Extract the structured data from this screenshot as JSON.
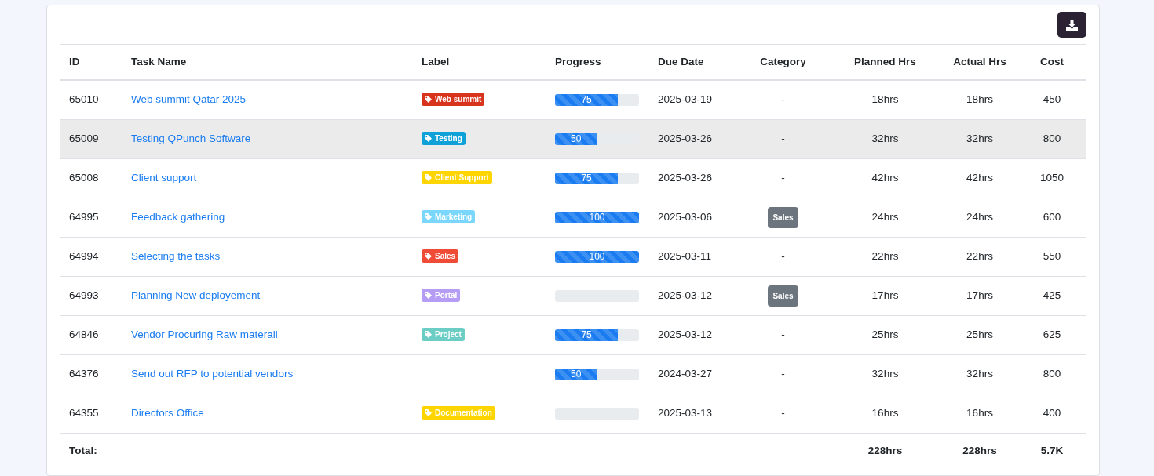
{
  "table": {
    "columns": [
      "ID",
      "Task Name",
      "Label",
      "Progress",
      "Due Date",
      "Category",
      "Planned Hrs",
      "Actual Hrs",
      "Cost"
    ],
    "rows": [
      {
        "id": "65010",
        "task": "Web summit Qatar 2025",
        "label": {
          "text": "Web summit",
          "color": "#d8341d"
        },
        "progress": {
          "level": 0.75,
          "text": "75"
        },
        "due": "2025-03-19",
        "category": "-",
        "planned": "18hrs",
        "actual": "18hrs",
        "cost": "450",
        "selected": false
      },
      {
        "id": "65009",
        "task": "Testing QPunch Software",
        "label": {
          "text": "Testing",
          "color": "#10a1d9"
        },
        "progress": {
          "level": 0.5,
          "text": "50"
        },
        "due": "2025-03-26",
        "category": "-",
        "planned": "32hrs",
        "actual": "32hrs",
        "cost": "800",
        "selected": true
      },
      {
        "id": "65008",
        "task": "Client support",
        "label": {
          "text": "Client Support",
          "color": "#ffd500"
        },
        "progress": {
          "level": 0.75,
          "text": "75"
        },
        "due": "2025-03-26",
        "category": "-",
        "planned": "42hrs",
        "actual": "42hrs",
        "cost": "1050",
        "selected": false
      },
      {
        "id": "64995",
        "task": "Feedback gathering",
        "label": {
          "text": "Marketing",
          "color": "#7ad6fb"
        },
        "progress": {
          "level": 1,
          "text": "100"
        },
        "due": "2025-03-06",
        "category_badge": "Sales",
        "planned": "24hrs",
        "actual": "24hrs",
        "cost": "600",
        "selected": false
      },
      {
        "id": "64994",
        "task": "Selecting the tasks",
        "label": {
          "text": "Sales",
          "color": "#f04b36"
        },
        "progress": {
          "level": 1,
          "text": "100"
        },
        "due": "2025-03-11",
        "category": "-",
        "planned": "22hrs",
        "actual": "22hrs",
        "cost": "550",
        "selected": false
      },
      {
        "id": "64993",
        "task": "Planning New deployement",
        "label": {
          "text": "Portal",
          "color": "#b59cf5"
        },
        "progress": {
          "level": 0
        },
        "due": "2025-03-12",
        "category_badge": "Sales",
        "planned": "17hrs",
        "actual": "17hrs",
        "cost": "425",
        "selected": false
      },
      {
        "id": "64846",
        "task": "Vendor Procuring Raw materail",
        "label": {
          "text": "Project",
          "color": "#6ccdc5"
        },
        "progress": {
          "level": 0.75,
          "text": "75"
        },
        "due": "2025-03-12",
        "category": "-",
        "planned": "25hrs",
        "actual": "25hrs",
        "cost": "625",
        "selected": false
      },
      {
        "id": "64376",
        "task": "Send out RFP to potential vendors",
        "progress": {
          "level": 0.5,
          "text": "50"
        },
        "due": "2024-03-27",
        "category": "-",
        "planned": "32hrs",
        "actual": "32hrs",
        "cost": "800",
        "selected": false
      },
      {
        "id": "64355",
        "task": "Directors Office",
        "label": {
          "text": "Documentation",
          "color": "#ffd500"
        },
        "progress": {
          "level": 0
        },
        "due": "2025-03-13",
        "category": "-",
        "planned": "16hrs",
        "actual": "16hrs",
        "cost": "400",
        "selected": false
      }
    ],
    "footer": {
      "label": "Total:",
      "planned": "228hrs",
      "actual": "228hrs",
      "cost": "5.7K"
    }
  }
}
